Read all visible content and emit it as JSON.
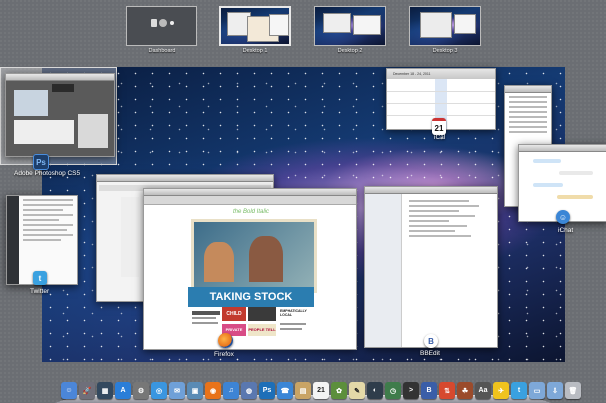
{
  "spaces": [
    {
      "label": "Dashboard",
      "active": false
    },
    {
      "label": "Desktop 1",
      "active": true
    },
    {
      "label": "Desktop 2",
      "active": false
    },
    {
      "label": "Desktop 3",
      "active": false
    }
  ],
  "windows": {
    "photoshop": {
      "label": "Adobe Photoshop CS5",
      "icon_text": "Ps",
      "color": "#1d6fb8"
    },
    "twitter": {
      "label": "Twitter",
      "color": "#3aa1e0"
    },
    "firefox": {
      "label": "Firefox",
      "color": "#e8731a"
    },
    "bbedit": {
      "label": "BBEdit",
      "color": "#3a5ea8"
    },
    "ical": {
      "label": "iCal",
      "date": "21",
      "header": "December 18 - 24, 2011"
    },
    "ichat": {
      "label": "iChat",
      "color": "#3b86d6"
    }
  },
  "firefox_page": {
    "masthead": "the Bold Italic",
    "headline": "TAKING STOCK",
    "tags": [
      "CHILD",
      "PRIVATE SCHOOL",
      "PEOPLE TELL",
      "EMPHATICALLY LOCAL"
    ]
  },
  "dock": {
    "items": [
      {
        "name": "finder-icon",
        "color": "#4b86d8",
        "glyph": "☺"
      },
      {
        "name": "launchpad-icon",
        "color": "#6f6f7a",
        "glyph": "🚀"
      },
      {
        "name": "mission-control-icon",
        "color": "#33495f",
        "glyph": "▦"
      },
      {
        "name": "app-store-icon",
        "color": "#2a7ed8",
        "glyph": "A"
      },
      {
        "name": "system-preferences-icon",
        "color": "#777",
        "glyph": "⚙"
      },
      {
        "name": "safari-icon",
        "color": "#3a96e0",
        "glyph": "◎"
      },
      {
        "name": "mail-icon",
        "color": "#6fa0d8",
        "glyph": "✉"
      },
      {
        "name": "preview-icon",
        "color": "#5a8bb5",
        "glyph": "▣"
      },
      {
        "name": "firefox-icon",
        "color": "#e8731a",
        "glyph": "◉"
      },
      {
        "name": "itunes-icon",
        "color": "#3d84d4",
        "glyph": "♫"
      },
      {
        "name": "network-icon",
        "color": "#5a78b0",
        "glyph": "◍"
      },
      {
        "name": "photoshop-icon",
        "color": "#1d6fb8",
        "glyph": "Ps"
      },
      {
        "name": "facetime-icon",
        "color": "#3b86d6",
        "glyph": "☎"
      },
      {
        "name": "notes-icon",
        "color": "#c9a465",
        "glyph": "▤"
      },
      {
        "name": "ical-icon",
        "color": "#f4f4f4",
        "glyph": "21"
      },
      {
        "name": "iphoto-icon",
        "color": "#5c8f3c",
        "glyph": "✿"
      },
      {
        "name": "textedit-icon",
        "color": "#e4d9a8",
        "glyph": "✎"
      },
      {
        "name": "activity-monitor-icon",
        "color": "#2f3d4b",
        "glyph": "◐"
      },
      {
        "name": "time-machine-icon",
        "color": "#3f7c4b",
        "glyph": "◷"
      },
      {
        "name": "terminal-icon",
        "color": "#333",
        "glyph": ">"
      },
      {
        "name": "bbedit-icon",
        "color": "#3a5ea8",
        "glyph": "B"
      },
      {
        "name": "transmit-icon",
        "color": "#d6492e",
        "glyph": "⇅"
      },
      {
        "name": "coda-icon",
        "color": "#9b4b2b",
        "glyph": "☘"
      },
      {
        "name": "dictionary-icon",
        "color": "#555",
        "glyph": "Aa"
      },
      {
        "name": "tweetie-icon",
        "color": "#f0c31e",
        "glyph": "✈"
      },
      {
        "name": "twitter-icon",
        "color": "#3aa1e0",
        "glyph": "t"
      },
      {
        "name": "folder-icon",
        "color": "#7ea8d8",
        "glyph": "▭"
      },
      {
        "name": "downloads-icon",
        "color": "#7ea8d8",
        "glyph": "⇩"
      },
      {
        "name": "trash-icon",
        "color": "#b9bcc2",
        "glyph": "🗑"
      }
    ]
  }
}
